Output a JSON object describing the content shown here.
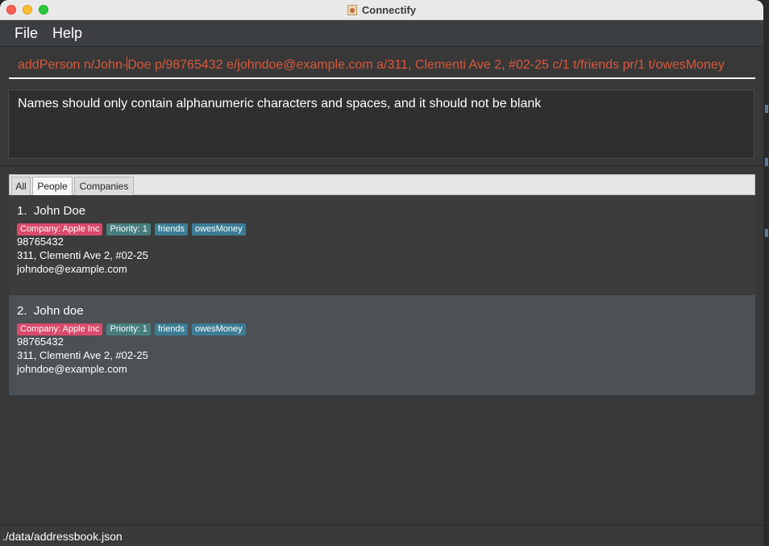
{
  "window": {
    "title": "Connectify"
  },
  "menu": {
    "file": "File",
    "help": "Help"
  },
  "command": {
    "before_caret": "addPerson n/John-",
    "after_caret": "Doe p/98765432 e/johndoe@example.com a/311, Clementi Ave 2, #02-25 c/1 t/friends pr/1 t/owesMoney"
  },
  "result": {
    "message": "Names should only contain alphanumeric characters and spaces, and it should not be blank"
  },
  "tabs": [
    {
      "label": "All"
    },
    {
      "label": "People",
      "selected": true
    },
    {
      "label": "Companies"
    }
  ],
  "people": [
    {
      "index": "1.",
      "name": "John Doe",
      "tags": [
        "Company: Apple Inc",
        "Priority: 1",
        "friends",
        "owesMoney"
      ],
      "phone": "98765432",
      "address": "311, Clementi Ave 2, #02-25",
      "email": "johndoe@example.com"
    },
    {
      "index": "2.",
      "name": "John doe",
      "tags": [
        "Company: Apple Inc",
        "Priority: 1",
        "friends",
        "owesMoney"
      ],
      "phone": "98765432",
      "address": "311, Clementi Ave 2, #02-25",
      "email": "johndoe@example.com"
    }
  ],
  "status": {
    "path": "./data/addressbook.json"
  },
  "colors": {
    "command_text": "#d9583b",
    "company_tag": "#d94a6b",
    "priority_tag": "#487d7e",
    "tag": "#3b7c94",
    "selected_card": "#4b5155"
  }
}
